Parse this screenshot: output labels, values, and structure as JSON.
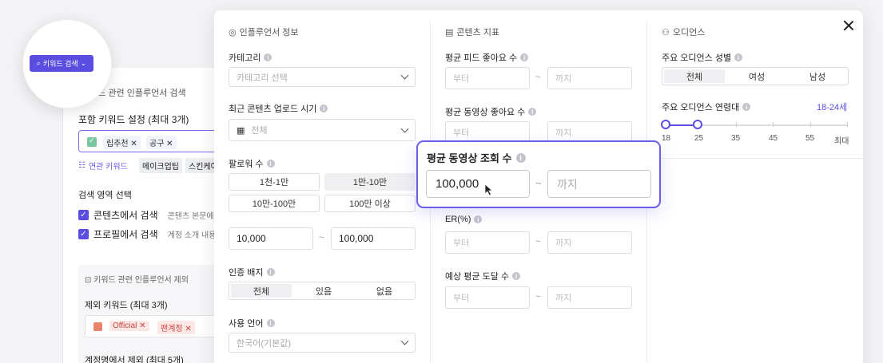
{
  "background": {
    "section_title": "키워드 관련 인플루언서 검색",
    "include_label": "포함 키워드 설정 (최대 3개)",
    "include_chips": [
      "립추천",
      "공구"
    ],
    "related_label": "연관 키워드",
    "related_chips": [
      "메이크업팁",
      "스킨케어"
    ],
    "area_label": "검색 영역 선택",
    "area_options": [
      {
        "label": "콘텐츠에서 검색",
        "hint": "콘텐츠 본문에"
      },
      {
        "label": "프로필에서 검색",
        "hint": "계정 소개 내용"
      }
    ],
    "exclude_title": "키워드 관련 인플루언서 제외",
    "exclude_label": "제외 키워드 (최대 3개)",
    "exclude_chips": [
      "Official",
      "팬계정"
    ],
    "account_exclude_label": "계정명에서 제외 (최대 5개)"
  },
  "magnifier": {
    "keyword_button": "키워드 검색"
  },
  "influencer": {
    "header": "인플루언서 정보",
    "category_label": "카테고리",
    "category_placeholder": "카테고리 선택",
    "upload_label": "최근 콘텐츠 업로드 시기",
    "upload_placeholder": "전체",
    "followers_label": "팔로워 수",
    "follower_ranges": [
      "1천-1만",
      "1만-10만",
      "10만-100만",
      "100만 이상"
    ],
    "follower_min": "10,000",
    "follower_max": "100,000",
    "badge_label": "인증 배지",
    "badge_options": [
      "전체",
      "있음",
      "없음"
    ],
    "language_label": "사용 언어",
    "language_placeholder": "한국어(기본값)"
  },
  "metrics": {
    "header": "콘텐츠 지표",
    "feed_like_label": "평균 피드 좋아요 수",
    "video_like_label": "평균 동영상 좋아요 수",
    "er_label": "ER(%)",
    "reach_label": "예상 평균 도달 수",
    "from_placeholder": "부터",
    "to_placeholder": "까지",
    "tilde": "~"
  },
  "popup": {
    "label": "평균 동영상 조회 수",
    "min_value": "100,000",
    "max_placeholder": "까지"
  },
  "audience": {
    "header": "오디언스",
    "gender_label": "주요 오디언스 성별",
    "gender_options": [
      "전체",
      "여성",
      "남성"
    ],
    "age_label": "주요 오디언스 연령대",
    "age_value": "18-24세",
    "age_ticks": [
      "18",
      "25",
      "35",
      "45",
      "55",
      "최대"
    ]
  },
  "colors": {
    "accent": "#5b4de0"
  }
}
